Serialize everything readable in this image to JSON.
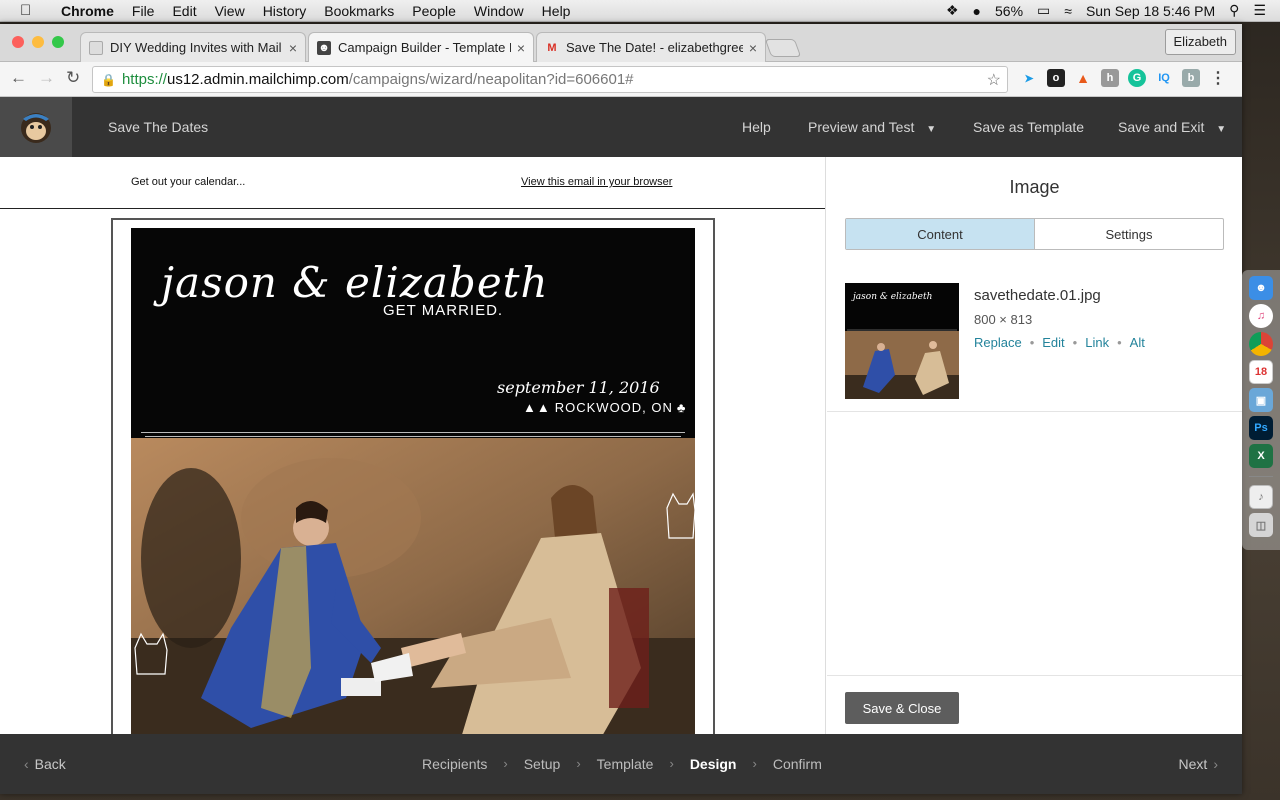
{
  "menubar": {
    "app": "Chrome",
    "items": [
      "File",
      "Edit",
      "View",
      "History",
      "Bookmarks",
      "People",
      "Window",
      "Help"
    ],
    "battery": "56%",
    "datetime": "Sun Sep 18  5:46 PM"
  },
  "browser": {
    "tabs": [
      {
        "title": "DIY Wedding Invites with Mail"
      },
      {
        "title": "Campaign Builder - Template D"
      },
      {
        "title": "Save The Date! - elizabethgree"
      }
    ],
    "profile": "Elizabeth",
    "url": {
      "scheme": "https://",
      "host": "us12.admin.mailchimp.com",
      "path": "/campaigns/wizard/neapolitan?id=606601#"
    }
  },
  "header": {
    "campaign_name": "Save The Dates",
    "help": "Help",
    "preview": "Preview and Test",
    "save_template": "Save as Template",
    "save_exit": "Save and Exit"
  },
  "email": {
    "preheader_text": "Get out your calendar...",
    "view_in_browser": "View this email in your browser",
    "invite": {
      "names": "jason & elizabeth",
      "subtitle": "GET MARRIED.",
      "date": "september 11, 2016",
      "location": "ROCKWOOD, ON"
    }
  },
  "sidebar": {
    "title": "Image",
    "tabs": [
      "Content",
      "Settings"
    ],
    "file_name": "savethedate.01.jpg",
    "dimensions": "800 × 813",
    "actions": [
      "Replace",
      "Edit",
      "Link",
      "Alt"
    ],
    "save_close": "Save & Close"
  },
  "footer": {
    "back": "Back",
    "steps": [
      "Recipients",
      "Setup",
      "Template",
      "Design",
      "Confirm"
    ],
    "current_step": "Design",
    "next": "Next"
  }
}
